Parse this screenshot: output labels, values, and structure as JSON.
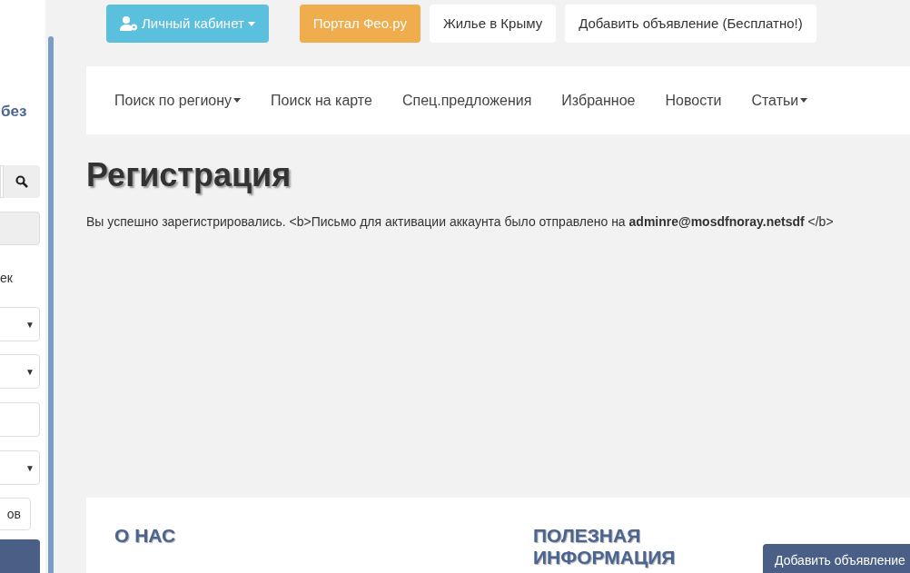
{
  "sidebar": {
    "title_fragment": "без",
    "label_fragment": "ек",
    "selects": [
      {
        "kind": "select",
        "arrow": "▼"
      },
      {
        "kind": "select",
        "arrow": "▼"
      },
      {
        "kind": "input"
      },
      {
        "kind": "select",
        "arrow": "▼"
      }
    ],
    "small_button": "ов"
  },
  "top_buttons": [
    {
      "label": "Личный кабинет",
      "kind": "cabinet",
      "caret": true
    },
    {
      "label": "Портал Фео.ру",
      "kind": "orange",
      "caret": false
    },
    {
      "label": "Жилье в Крыму",
      "kind": "plain",
      "caret": false
    },
    {
      "label": "Добавить объявление (Бесплатно!)",
      "kind": "plain",
      "caret": false
    }
  ],
  "nav": [
    {
      "label": "Поиск по региону",
      "caret": true
    },
    {
      "label": "Поиск на карте",
      "caret": false
    },
    {
      "label": "Спец.предложения",
      "caret": false
    },
    {
      "label": "Избранное",
      "caret": false
    },
    {
      "label": "Новости",
      "caret": false
    },
    {
      "label": "Статьи",
      "caret": true
    }
  ],
  "heading": "Регистрация",
  "message": "Вы успешно зарегистрировались. <b>Письмо для активации аккаунта было отправлено на **adminre@mosdfnoray.netsdf** </b>",
  "footer": {
    "headings": [
      "О НАС",
      "ПОЛЕЗНАЯ ИНФОРМАЦИЯ"
    ],
    "add_button": "Добавить объявление"
  }
}
